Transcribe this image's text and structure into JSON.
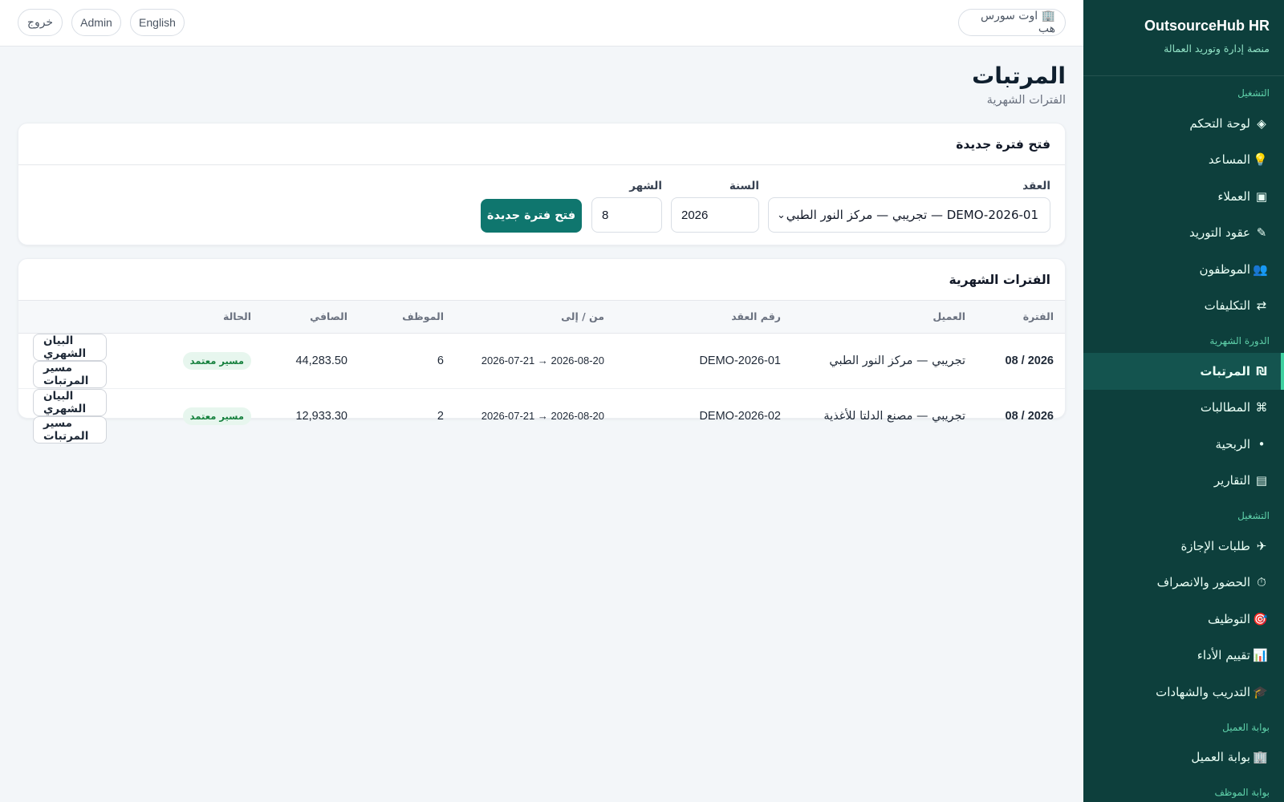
{
  "sidebar": {
    "brand_title": "OutsourceHub HR",
    "brand_subtitle": "منصة إدارة وتوريد العمالة",
    "sections": [
      {
        "title": "التشغيل",
        "items": [
          {
            "icon": "◈",
            "icon_name": "dashboard-icon",
            "label": "لوحة التحكم"
          },
          {
            "icon": "💡",
            "icon_name": "bulb-icon",
            "label": "المساعد"
          },
          {
            "icon": "▣",
            "icon_name": "clients-icon",
            "label": "العملاء"
          },
          {
            "icon": "✎",
            "icon_name": "pencil-icon",
            "label": "عقود التوريد"
          },
          {
            "icon": "👥",
            "icon_name": "people-icon",
            "label": "الموظفون"
          },
          {
            "icon": "⇄",
            "icon_name": "swap-icon",
            "label": "التكليفات"
          }
        ]
      },
      {
        "title": "الدورة الشهرية",
        "items": [
          {
            "icon": "₪",
            "icon_name": "currency-icon",
            "label": "المرتبات",
            "active": true
          },
          {
            "icon": "⌘",
            "icon_name": "command-icon",
            "label": "المطالبات"
          },
          {
            "icon": "•",
            "icon_name": "dot-icon",
            "label": "الربحية"
          },
          {
            "icon": "▤",
            "icon_name": "reports-icon",
            "label": "التقارير"
          }
        ]
      },
      {
        "title": "التشغيل",
        "items": [
          {
            "icon": "✈",
            "icon_name": "plane-icon",
            "label": "طلبات الإجازة"
          },
          {
            "icon": "⏱",
            "icon_name": "clock-icon",
            "label": "الحضور والانصراف"
          },
          {
            "icon": "🎯",
            "icon_name": "target-icon",
            "label": "التوظيف"
          },
          {
            "icon": "📊",
            "icon_name": "chart-icon",
            "label": "تقييم الأداء"
          },
          {
            "icon": "🎓",
            "icon_name": "graduation-icon",
            "label": "التدريب والشهادات"
          }
        ]
      },
      {
        "title": "بوابة العميل",
        "items": [
          {
            "icon": "🏢",
            "icon_name": "building-icon",
            "label": "بوابة العميل"
          }
        ]
      },
      {
        "title": "بوابة الموظف",
        "items": []
      }
    ]
  },
  "topbar": {
    "org_label": "🏢 اوت سورس هب",
    "language_label": "English",
    "user_label": "Admin",
    "logout_label": "خروج"
  },
  "page": {
    "title": "المرتبات",
    "subtitle": "الفترات الشهرية"
  },
  "new_period_form": {
    "heading": "فتح فترة جديدة",
    "contract_label": "العقد",
    "contract_value": "DEMO-2026-01 — تجريبي — مركز النور الطبي",
    "year_label": "السنة",
    "year_value": "2026",
    "month_label": "الشهر",
    "month_value": "8",
    "submit_label": "فتح فترة جديدة"
  },
  "periods": {
    "heading": "الفترات الشهرية",
    "columns": [
      "الفترة",
      "العميل",
      "رقم العقد",
      "من / إلى",
      "الموظف",
      "الصافي",
      "الحالة"
    ],
    "rows": [
      {
        "period": "08 / 2026",
        "client": "تجريبي — مركز النور الطبي",
        "contract": "DEMO-2026-01",
        "range": "2026-07-21 → 2026-08-20",
        "employees": "6",
        "net": "44,283.50",
        "status": "مسير معتمد",
        "action_statement": "البيان الشهري",
        "action_payroll": "مسير المرتبات"
      },
      {
        "period": "08 / 2026",
        "client": "تجريبي — مصنع الدلتا للأغذية",
        "contract": "DEMO-2026-02",
        "range": "2026-07-21 → 2026-08-20",
        "employees": "2",
        "net": "12,933.30",
        "status": "مسير معتمد",
        "action_statement": "البيان الشهري",
        "action_payroll": "مسير المرتبات"
      }
    ]
  },
  "colors": {
    "sidebar_bg": "#0d3f3c",
    "accent": "#0f766e",
    "status_green": "#15803d"
  }
}
